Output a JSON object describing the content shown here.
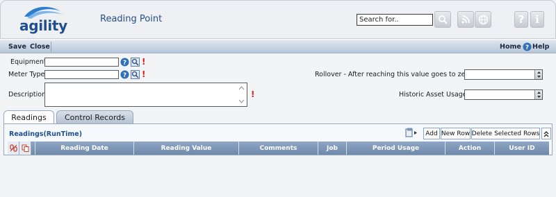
{
  "app": {
    "logo_text": "agility",
    "page_title": "Reading Point"
  },
  "header": {
    "search_value": "Search for..",
    "icons": [
      "search-icon",
      "rss-icon",
      "globe-icon",
      "help-icon",
      "info-icon"
    ],
    "help_label": "?",
    "info_label": "i"
  },
  "toolbar": {
    "save_label": "Save",
    "close_label": "Close",
    "home_label": "Home",
    "help_label": "Help"
  },
  "form": {
    "equipment_label": "Equipment",
    "meter_type_label": "Meter Type",
    "description_label": "Description",
    "rollover_label": "Rollover - After reaching this value goes to zero",
    "historic_label": "Historic Asset Usage",
    "required_mark": "!",
    "equipment_value": "",
    "meter_type_value": "",
    "description_value": "",
    "rollover_value": "",
    "historic_value": ""
  },
  "tabs": [
    {
      "label": "Readings",
      "active": true
    },
    {
      "label": "Control Records",
      "active": false
    }
  ],
  "grid": {
    "title": "Readings(RunTime)",
    "add_label": "Add",
    "new_row_label": "New Row",
    "delete_label": "Delete Selected Rows",
    "columns": [
      "Reading Date",
      "Reading Value",
      "Comments",
      "Job",
      "Period Usage",
      "Action",
      "User ID"
    ]
  },
  "colors": {
    "brand_blue": "#1f4f8f",
    "required_red": "#e11b1b",
    "grid_header": "#7f97b8",
    "toolbar": "#c8d4e3"
  }
}
